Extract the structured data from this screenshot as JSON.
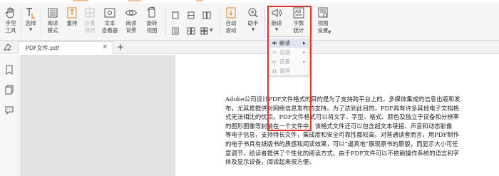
{
  "ribbon": {
    "hand": "手型\n工具",
    "select": "选择",
    "readmode": "阅读\n模式",
    "reflow": "重排",
    "wrap": "折叠\n排列",
    "textviewer": "文本\n查看器",
    "readbg": "阅读\n背景",
    "rotate": "旋转\n视图",
    "autoscroll": "自动\n滚动",
    "assistant": "助手",
    "readaloud": "朗读",
    "wordcount": "字数\n统计",
    "viewsettings": "视图\n设置"
  },
  "wordcount_badge": "AB",
  "tabs": [
    {
      "title": "PDF文件.pdf"
    }
  ],
  "newtab": "+",
  "tabclose": "×",
  "menu": {
    "items": [
      {
        "label": "朗读",
        "state": "active"
      },
      {
        "label": "语速",
        "state": "disabled"
      },
      {
        "label": "音量",
        "state": "disabled"
      },
      {
        "label": "暂停",
        "state": "disabled"
      }
    ]
  },
  "document": {
    "lines": [
      "Adobe公司设计PDF文件格式的目的是为了支持跨平台上的，多媒体集成的信息出版和发",
      "布，尤其是提供对网络信息发布的支持。为了达到此目的，PDF具有许多其他电子文档格",
      "式无法相比的优点。PDF文件格式可以将文字、字型、格式、颜色及独立于设备和分辨率",
      "的图形图像等封装在一个文件中。该格式文件还可以包含超文本链接、声音和动态影像",
      "等电子信息，支持特长文件，集成度和安全可靠性都较高。对普通读者而言，用PDF制作",
      "的电子书具有纸版书的质感和阅读效果，可以“逼真地”展现原书的原貌，而显示大小可任",
      "意调节，给读者提供了个性化的阅读方式。由于PDF文件可以不依赖操作系统的语言和字",
      "体及显示设备，阅读起来很方便。"
    ]
  },
  "colors": {
    "highlight": "#e0302b",
    "menu_active": "#dfe6f0",
    "accent": "#f0c19b"
  }
}
